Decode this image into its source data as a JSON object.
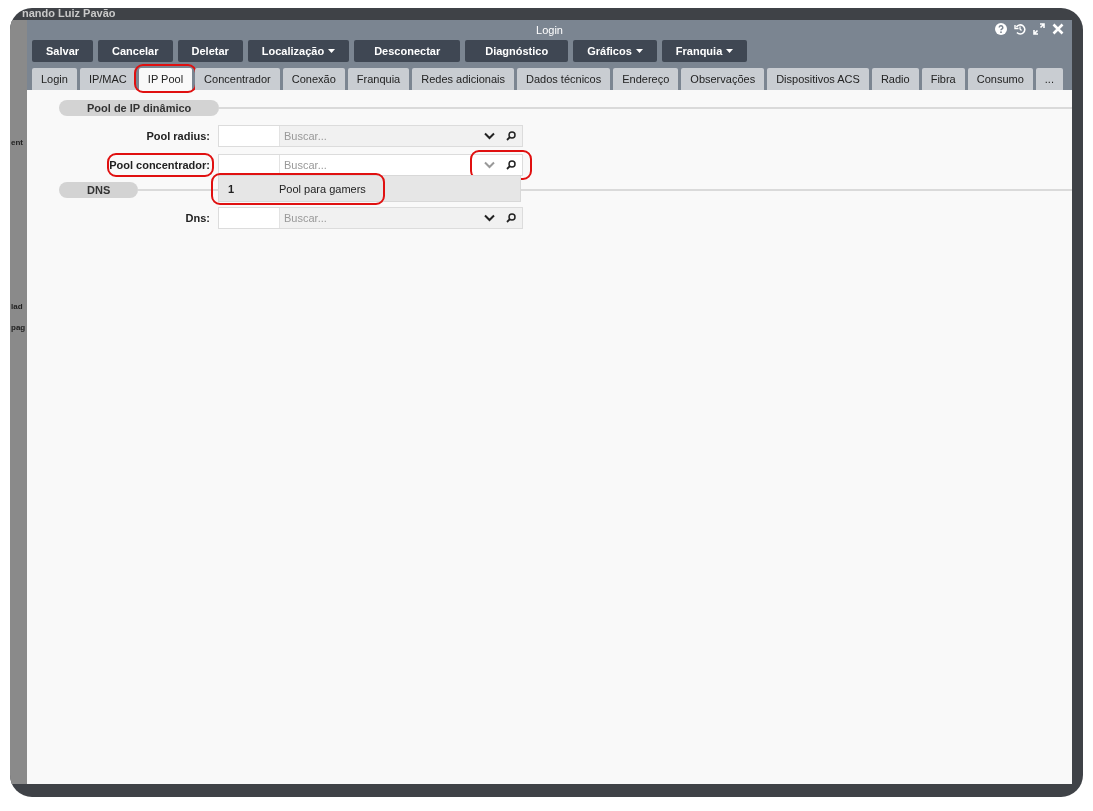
{
  "background": {
    "user_name": "nando Luiz Pavão",
    "side_fragments": [
      "ent",
      "lad",
      "pag"
    ]
  },
  "window": {
    "title": "Login"
  },
  "toolbar": [
    {
      "label": "Salvar",
      "kind": "plain"
    },
    {
      "label": "Cancelar",
      "kind": "plain"
    },
    {
      "label": "Deletar",
      "kind": "plain"
    },
    {
      "label": "Localização",
      "kind": "menu"
    },
    {
      "label": "Desconectar",
      "kind": "plain"
    },
    {
      "label": "Diagnóstico",
      "kind": "plain"
    },
    {
      "label": "Gráficos",
      "kind": "menu"
    },
    {
      "label": "Franquia",
      "kind": "menu"
    }
  ],
  "tabs": [
    {
      "label": "Login",
      "selected": false,
      "highlighted": false
    },
    {
      "label": "IP/MAC",
      "selected": false,
      "highlighted": false
    },
    {
      "label": "IP Pool",
      "selected": true,
      "highlighted": true
    },
    {
      "label": "Concentrador",
      "selected": false,
      "highlighted": false
    },
    {
      "label": "Conexão",
      "selected": false,
      "highlighted": false
    },
    {
      "label": "Franquia",
      "selected": false,
      "highlighted": false
    },
    {
      "label": "Redes adicionais",
      "selected": false,
      "highlighted": false
    },
    {
      "label": "Dados técnicos",
      "selected": false,
      "highlighted": false
    },
    {
      "label": "Endereço",
      "selected": false,
      "highlighted": false
    },
    {
      "label": "Observações",
      "selected": false,
      "highlighted": false
    },
    {
      "label": "Dispositivos ACS",
      "selected": false,
      "highlighted": false
    },
    {
      "label": "Radio",
      "selected": false,
      "highlighted": false
    },
    {
      "label": "Fibra",
      "selected": false,
      "highlighted": false
    },
    {
      "label": "Consumo",
      "selected": false,
      "highlighted": false
    },
    {
      "label": "...",
      "selected": false,
      "highlighted": false
    }
  ],
  "sections": [
    {
      "title": "Pool de IP dinâmico",
      "fields": [
        {
          "label": "Pool radius:",
          "placeholder": "Buscar...",
          "focused": false,
          "highlighted": false
        },
        {
          "label": "Pool concentrador:",
          "placeholder": "Buscar...",
          "focused": true,
          "highlighted": true,
          "options": [
            {
              "id": "1",
              "name": "Pool para gamers",
              "highlighted": true
            }
          ]
        }
      ]
    },
    {
      "title": "DNS",
      "fields": [
        {
          "label": "Dns:",
          "placeholder": "Buscar...",
          "focused": false,
          "highlighted": false
        }
      ]
    }
  ]
}
